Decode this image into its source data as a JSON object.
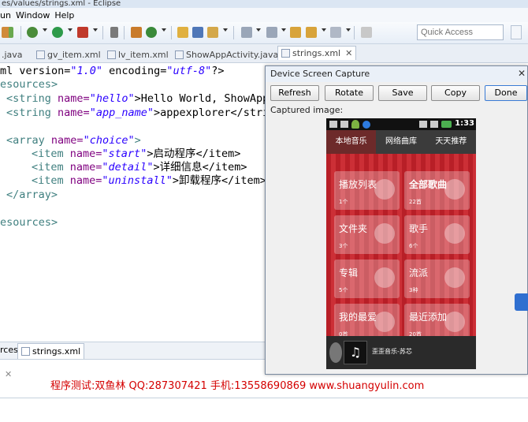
{
  "window": {
    "title": "es/values/strings.xml - Eclipse"
  },
  "menu": {
    "items": [
      "un",
      "Window",
      "Help"
    ]
  },
  "quick_access": {
    "placeholder": "Quick Access"
  },
  "tabs": [
    {
      "label": ".java"
    },
    {
      "label": "gv_item.xml"
    },
    {
      "label": "lv_item.xml"
    },
    {
      "label": "ShowAppActivity.java"
    },
    {
      "label": "strings.xml",
      "active": true
    }
  ],
  "code": {
    "line1": {
      "a": "ml version=",
      "b": "\"1.0\"",
      "c": " encoding=",
      "d": "\"utf-8\"",
      "e": "?>"
    },
    "line2": "esources>",
    "line3": {
      "tag": "<string",
      "attr": " name=",
      "val": "\"hello\"",
      "rest": ">Hello World, ShowApp"
    },
    "line4": {
      "tag": "<string",
      "attr": " name=",
      "val": "\"app_name\"",
      "rest": ">appexplorer</stri"
    },
    "line5": {
      "tag": "<array",
      "attr": " name=",
      "val": "\"choice\"",
      "rest": ">"
    },
    "line6": {
      "tag": "<item",
      "attr": " name=",
      "val": "\"start\"",
      "rest": ">启动程序</item>"
    },
    "line7": {
      "tag": "<item",
      "attr": " name=",
      "val": "\"detail\"",
      "rest": ">详细信息</item>"
    },
    "line8": {
      "tag": "<item",
      "attr": " name=",
      "val": "\"uninstall\"",
      "rest": ">卸载程序</item>"
    },
    "line9": "</array>",
    "line10": "esources>"
  },
  "bottom_tabs": {
    "left": "rces",
    "right": "strings.xml"
  },
  "watermark": "程序测试:双鱼林 QQ:287307421 手机:13558690869 www.shuangyulin.com",
  "dialog": {
    "title": "Device Screen Capture",
    "close": "✕",
    "buttons": {
      "refresh": "Refresh",
      "rotate": "Rotate",
      "save": "Save",
      "copy": "Copy",
      "done": "Done"
    },
    "captured_label": "Captured image:"
  },
  "phone": {
    "time": "1:33",
    "tabs": [
      "本地音乐",
      "网络曲库",
      "天天推荐"
    ],
    "tiles": [
      {
        "title": "播放列表",
        "count": "1个"
      },
      {
        "title": "全部歌曲",
        "count": "22首"
      },
      {
        "title": "文件夹",
        "count": "3个"
      },
      {
        "title": "歌手",
        "count": "6个"
      },
      {
        "title": "专辑",
        "count": "5个"
      },
      {
        "title": "流派",
        "count": "3种"
      },
      {
        "title": "我的最爱",
        "count": "0首"
      },
      {
        "title": "最近添加",
        "count": "20首"
      }
    ],
    "player_text": "歪歪音乐-苏芯"
  },
  "colors": {
    "tag": "#3f7f7f",
    "attr": "#7f007f",
    "value": "#2a00ff",
    "phone_red": "#c1272d",
    "watermark": "#d40000"
  }
}
